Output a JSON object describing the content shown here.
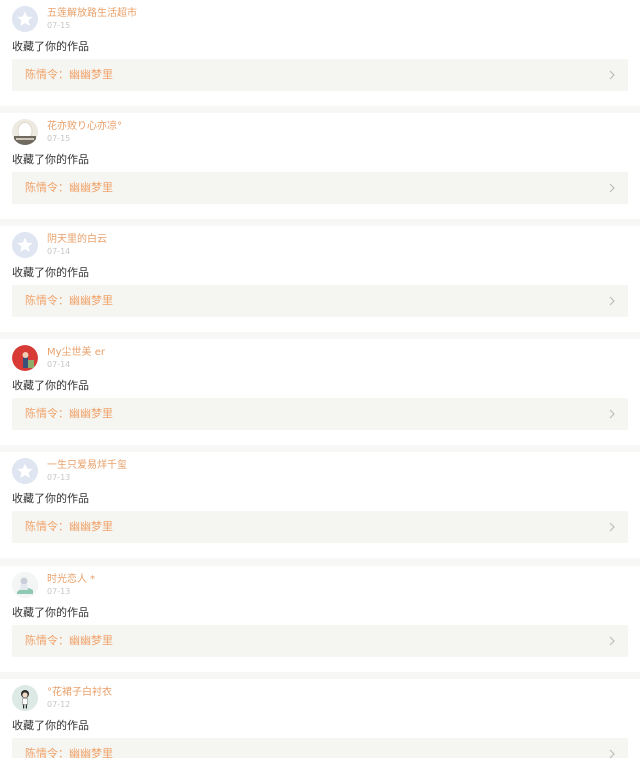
{
  "colors": {
    "username": "#e8a06a",
    "work_title": "#f0a36b",
    "date": "#c6c6c6",
    "action": "#333333",
    "link_background": "#f5f5f1",
    "page_background": "#f7f7f5"
  },
  "notifications": [
    {
      "username": "五莲解放路生活超市",
      "date": "07-15",
      "avatar_icon": "default-star-avatar-icon",
      "action": "收藏了你的作品",
      "work": {
        "title": "陈情令：幽幽梦里",
        "chevron_icon": "chevron-right-icon"
      }
    },
    {
      "username": "花亦败り心亦凉°",
      "date": "07-15",
      "avatar_icon": "white-egg-avatar-icon",
      "action": "收藏了你的作品",
      "work": {
        "title": "陈情令：幽幽梦里",
        "chevron_icon": "chevron-right-icon"
      }
    },
    {
      "username": "阴天里的白云",
      "date": "07-14",
      "avatar_icon": "default-star-avatar-icon",
      "action": "收藏了你的作品",
      "work": {
        "title": "陈情令：幽幽梦里",
        "chevron_icon": "chevron-right-icon"
      }
    },
    {
      "username": "My尘世美 er",
      "date": "07-14",
      "avatar_icon": "red-photo-avatar-icon",
      "action": "收藏了你的作品",
      "work": {
        "title": "陈情令：幽幽梦里",
        "chevron_icon": "chevron-right-icon"
      }
    },
    {
      "username": "一生只爱易烊千玺",
      "date": "07-13",
      "avatar_icon": "default-star-avatar-icon",
      "action": "收藏了你的作品",
      "work": {
        "title": "陈情令：幽幽梦里",
        "chevron_icon": "chevron-right-icon"
      }
    },
    {
      "username": "时光恋人 *",
      "date": "07-13",
      "avatar_icon": "anime-girl-avatar-icon",
      "action": "收藏了你的作品",
      "work": {
        "title": "陈情令：幽幽梦里",
        "chevron_icon": "chevron-right-icon"
      }
    },
    {
      "username": "°花裙子白衬衣",
      "date": "07-12",
      "avatar_icon": "cartoon-girl-avatar-icon",
      "action": "收藏了你的作品",
      "work": {
        "title": "陈情令：幽幽梦里",
        "chevron_icon": "chevron-right-icon"
      }
    }
  ]
}
